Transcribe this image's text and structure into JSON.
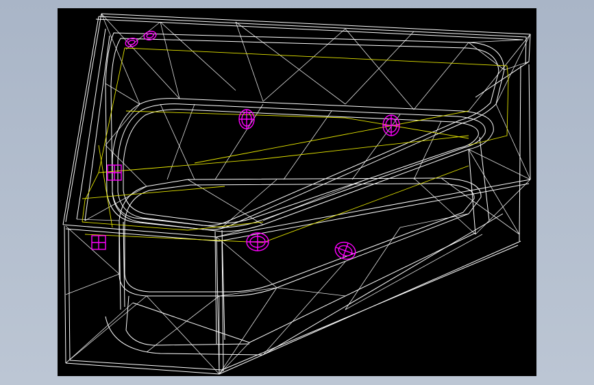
{
  "viewport": {
    "background": "#000000",
    "frame_background": "#b3bfcf"
  },
  "model": {
    "subject": "corner-bathtub-wireframe",
    "edge_color": "#ffffff",
    "guide_color": "#e6e600",
    "fitting_color": "#ff00ff",
    "fittings_count": 8
  }
}
